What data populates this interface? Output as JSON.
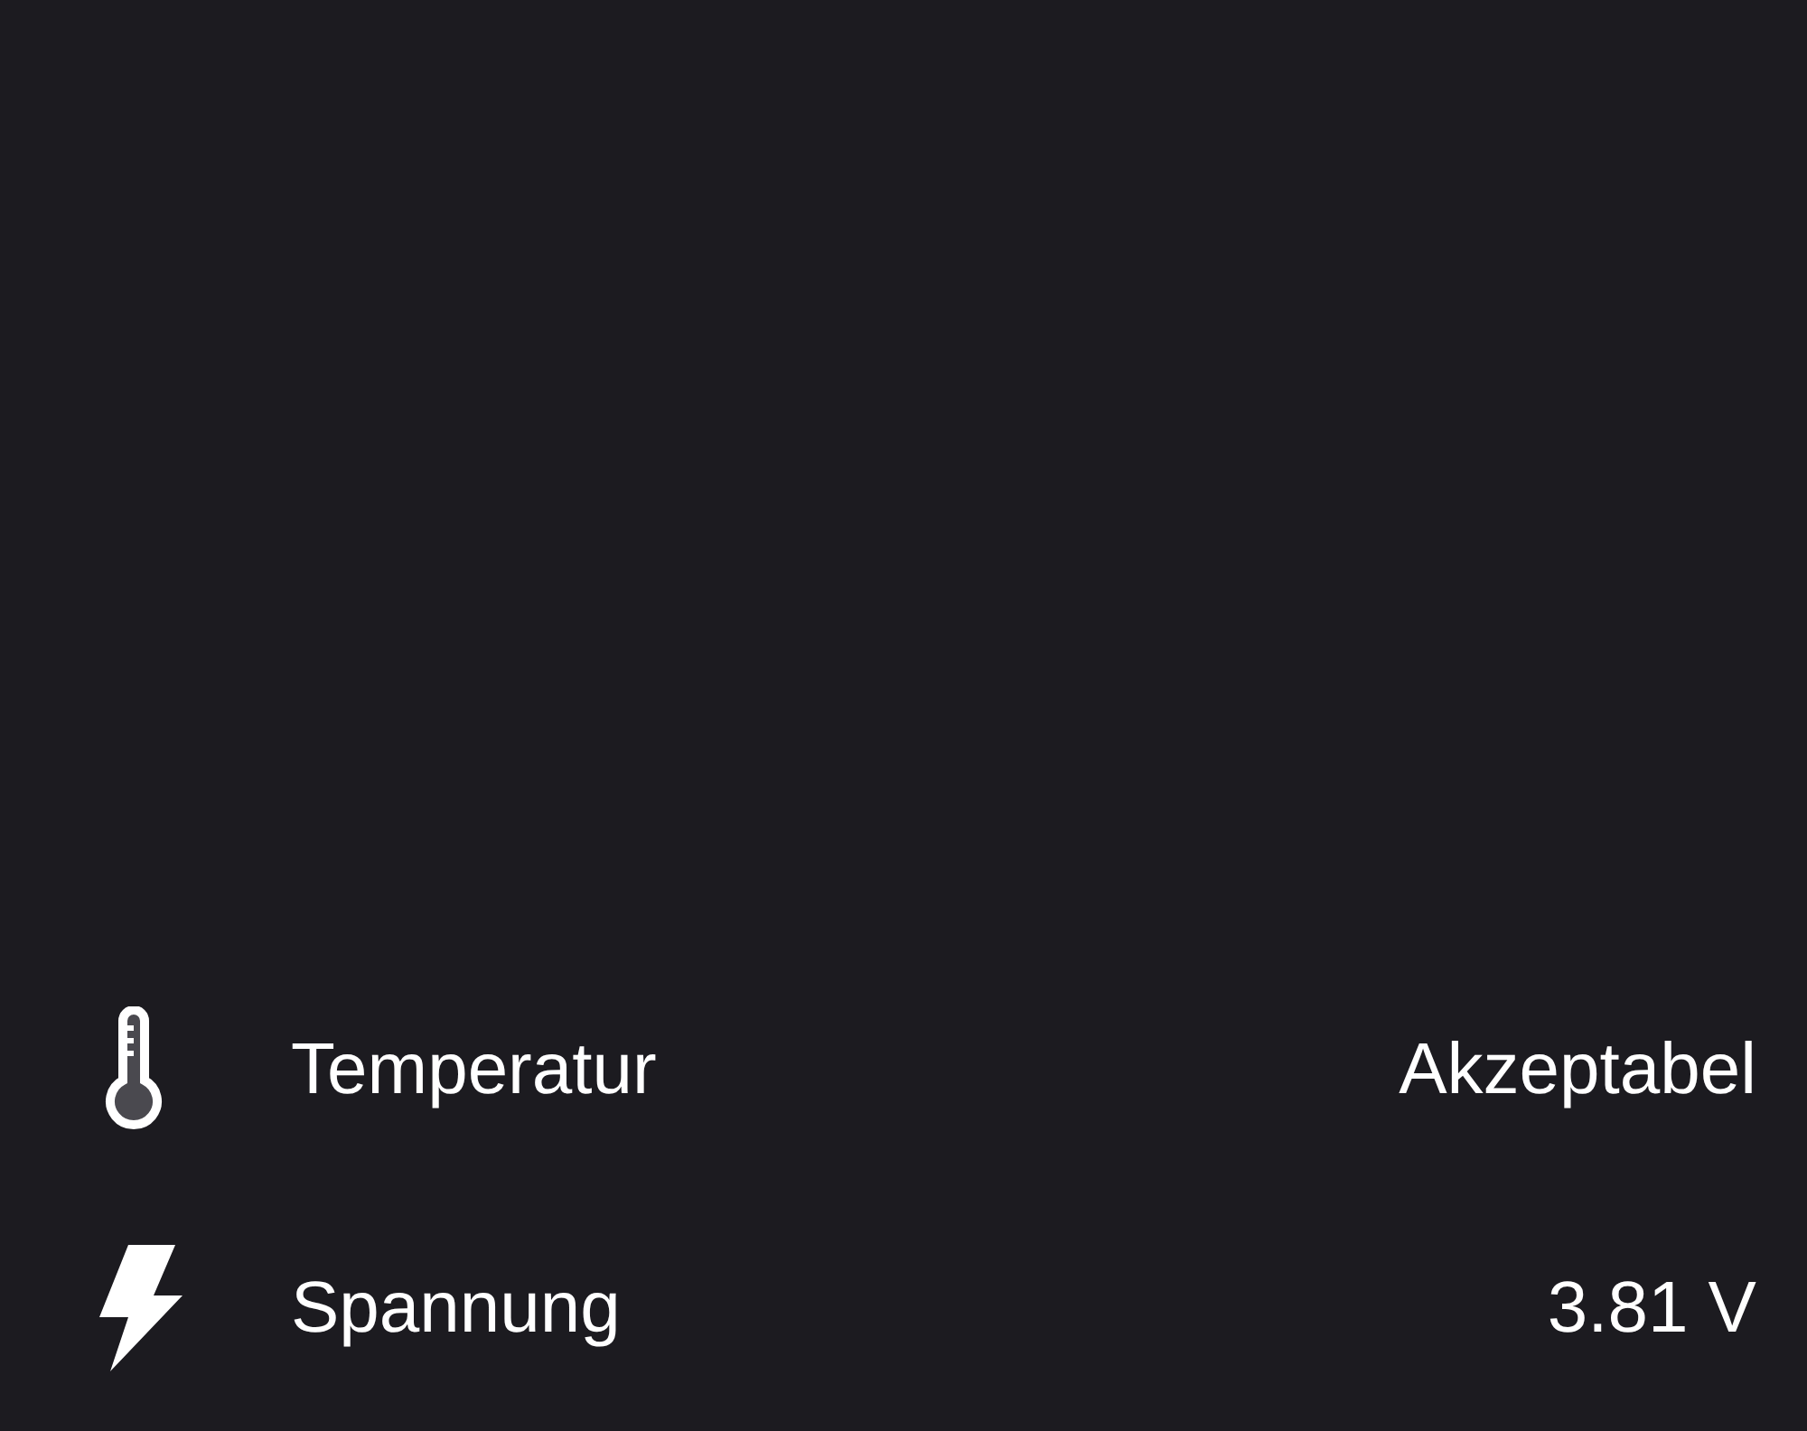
{
  "rows": [
    {
      "kind": "temperature",
      "label": "Temperatur",
      "value": "Akzeptabel"
    },
    {
      "kind": "voltage",
      "label": "Spannung",
      "value": "3.81 V"
    }
  ]
}
